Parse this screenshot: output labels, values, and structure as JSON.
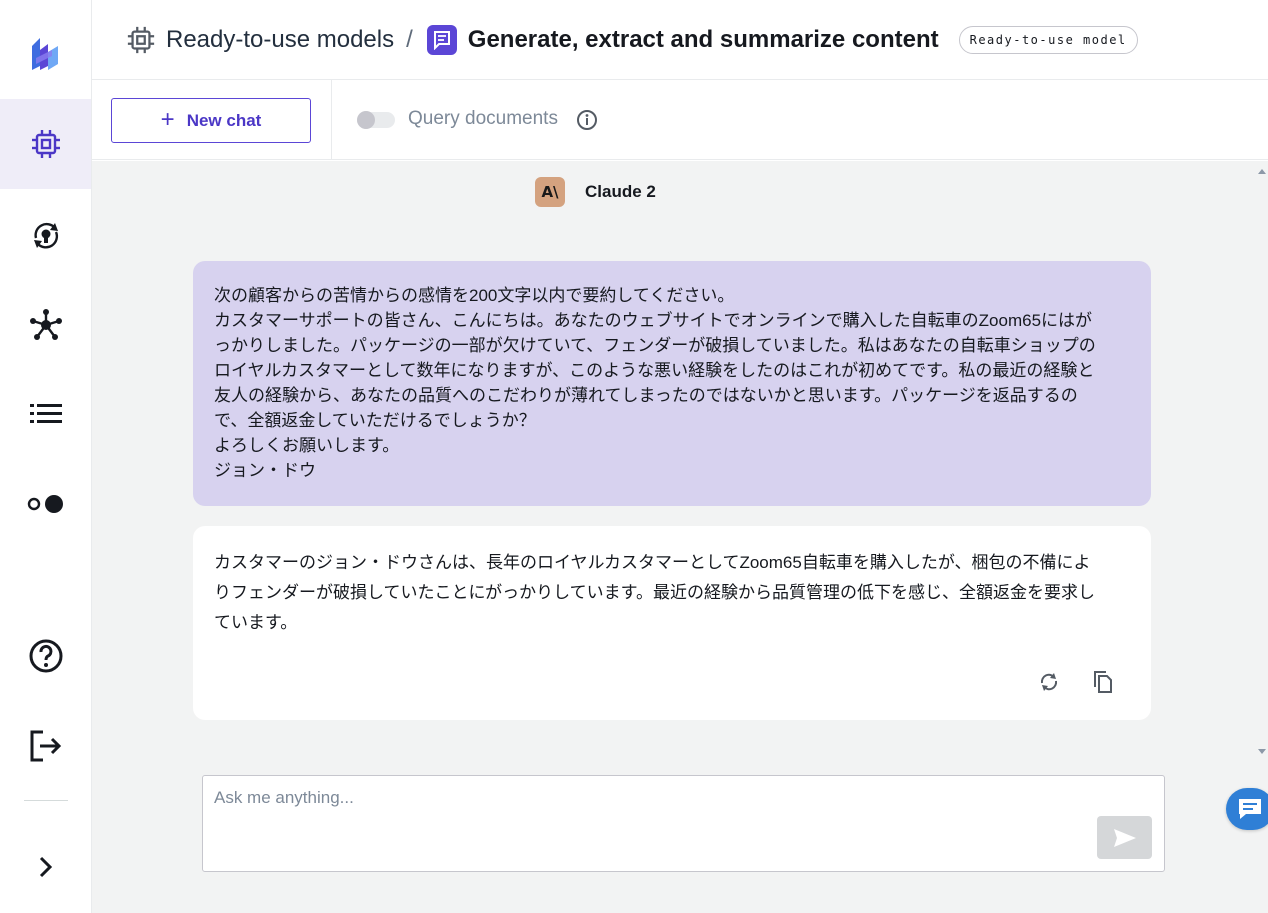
{
  "header": {
    "breadcrumb_parent": "Ready-to-use models",
    "breadcrumb_separator": "/",
    "page_title": "Generate, extract and summarize content",
    "badge": "Ready-to-use model"
  },
  "sidebar": {
    "items": [
      {
        "icon": "chip-icon",
        "active": true
      },
      {
        "icon": "refresh-bulb-icon",
        "active": false
      },
      {
        "icon": "network-icon",
        "active": false
      },
      {
        "icon": "list-icon",
        "active": false
      },
      {
        "icon": "toggle-dots-icon",
        "active": false
      }
    ],
    "bottom_items": [
      {
        "icon": "help-icon"
      },
      {
        "icon": "sign-out-icon"
      },
      {
        "icon": "chevron-right-icon"
      }
    ]
  },
  "toolbar": {
    "new_chat_label": "New chat",
    "query_documents_label": "Query documents",
    "query_documents_enabled": false
  },
  "chat": {
    "model_avatar_text": "A\\",
    "model_name": "Claude 2",
    "user_message": [
      "次の顧客からの苦情からの感情を200文字以内で要約してください。",
      "カスタマーサポートの皆さん、こんにちは。あなたのウェブサイトでオンラインで購入した自転車のZoom65にはが",
      "っかりしました。パッケージの一部が欠けていて、フェンダーが破損していました。私はあなたの自転車ショップの",
      "ロイヤルカスタマーとして数年になりますが、このような悪い経験をしたのはこれが初めてです。私の最近の経験と",
      "友人の経験から、あなたの品質へのこだわりが薄れてしまったのではないかと思います。パッケージを返品するの",
      "で、全額返金していただけるでしょうか？",
      "よろしくお願いします。",
      "ジョン・ドウ"
    ],
    "assistant_message": [
      "カスタマーのジョン・ドウさんは、長年のロイヤルカスタマーとしてZoom65自転車を購入したが、梱包の不備によ",
      "りフェンダーが破損していたことにがっかりしています。最近の経験から品質管理の低下を感じ、全額返金を要求し",
      "ています。"
    ]
  },
  "input": {
    "placeholder": "Ask me anything...",
    "value": ""
  },
  "colors": {
    "accent": "#5b46d6",
    "user_bubble": "#d7d2ef",
    "background": "#f2f3f3",
    "feedback_button": "#2f7fd6"
  }
}
